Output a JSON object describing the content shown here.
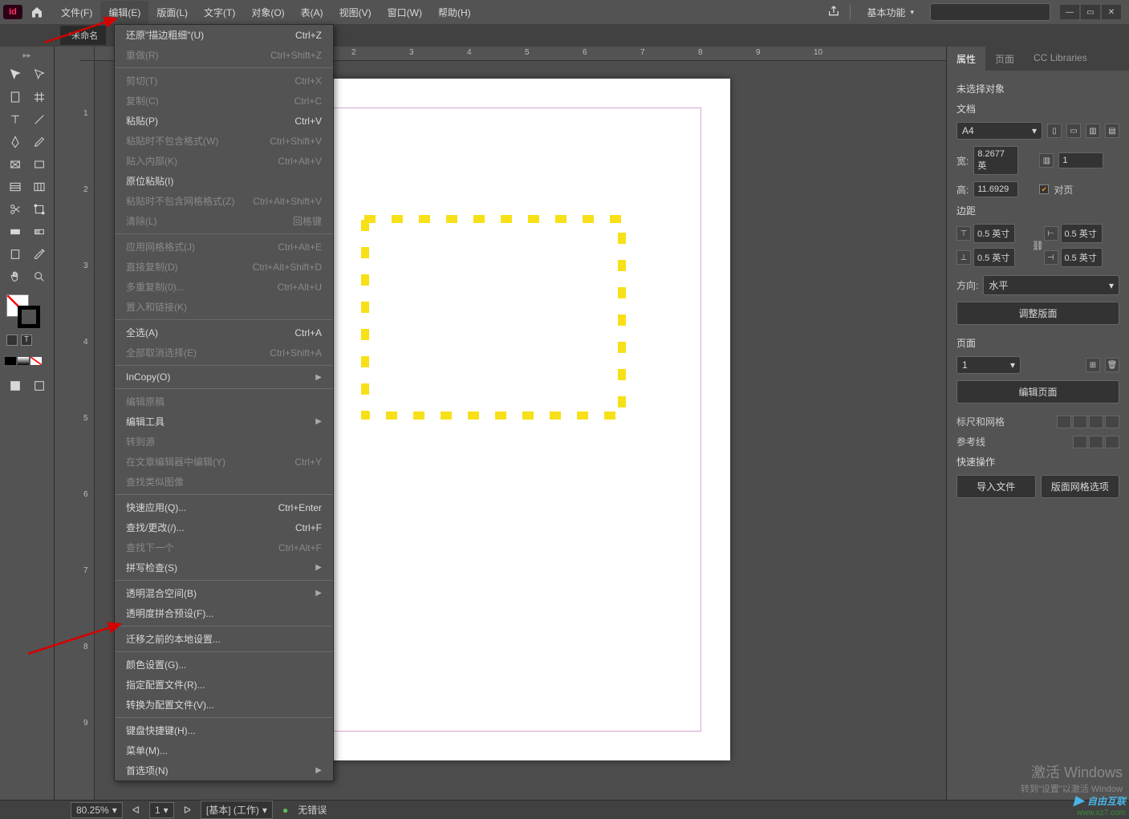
{
  "app": {
    "logo": "Id"
  },
  "menubar": {
    "items": [
      "文件(F)",
      "编辑(E)",
      "版面(L)",
      "文字(T)",
      "对象(O)",
      "表(A)",
      "视图(V)",
      "窗口(W)",
      "帮助(H)"
    ],
    "active_index": 1
  },
  "workspace": {
    "label": "基本功能"
  },
  "doc_tab": {
    "title": "*未命名"
  },
  "dropdown": {
    "groups": [
      [
        {
          "label": "还原\"描边粗细\"(U)",
          "sc": "Ctrl+Z",
          "d": false
        },
        {
          "label": "重做(R)",
          "sc": "Ctrl+Shift+Z",
          "d": true
        }
      ],
      [
        {
          "label": "剪切(T)",
          "sc": "Ctrl+X",
          "d": true
        },
        {
          "label": "复制(C)",
          "sc": "Ctrl+C",
          "d": true
        },
        {
          "label": "粘贴(P)",
          "sc": "Ctrl+V",
          "d": false
        },
        {
          "label": "粘贴时不包含格式(W)",
          "sc": "Ctrl+Shift+V",
          "d": true
        },
        {
          "label": "贴入内部(K)",
          "sc": "Ctrl+Alt+V",
          "d": true
        },
        {
          "label": "原位粘贴(I)",
          "sc": "",
          "d": false
        },
        {
          "label": "粘贴时不包含网格格式(Z)",
          "sc": "Ctrl+Alt+Shift+V",
          "d": true
        },
        {
          "label": "清除(L)",
          "sc": "回格键",
          "d": true
        }
      ],
      [
        {
          "label": "应用网格格式(J)",
          "sc": "Ctrl+Alt+E",
          "d": true
        },
        {
          "label": "直接复制(D)",
          "sc": "Ctrl+Alt+Shift+D",
          "d": true
        },
        {
          "label": "多重复制(0)...",
          "sc": "Ctrl+Alt+U",
          "d": true
        },
        {
          "label": "置入和链接(K)",
          "sc": "",
          "d": true
        }
      ],
      [
        {
          "label": "全选(A)",
          "sc": "Ctrl+A",
          "d": false
        },
        {
          "label": "全部取消选择(E)",
          "sc": "Ctrl+Shift+A",
          "d": true
        }
      ],
      [
        {
          "label": "InCopy(O)",
          "sc": "",
          "d": false,
          "sub": true
        }
      ],
      [
        {
          "label": "编辑原稿",
          "sc": "",
          "d": true
        },
        {
          "label": "编辑工具",
          "sc": "",
          "d": false,
          "sub": true
        },
        {
          "label": "转到源",
          "sc": "",
          "d": true
        },
        {
          "label": "在文章编辑器中编辑(Y)",
          "sc": "Ctrl+Y",
          "d": true
        },
        {
          "label": "查找类似图像",
          "sc": "",
          "d": true
        }
      ],
      [
        {
          "label": "快速应用(Q)...",
          "sc": "Ctrl+Enter",
          "d": false
        },
        {
          "label": "查找/更改(/)...",
          "sc": "Ctrl+F",
          "d": false
        },
        {
          "label": "查找下一个",
          "sc": "Ctrl+Alt+F",
          "d": true
        },
        {
          "label": "拼写检查(S)",
          "sc": "",
          "d": false,
          "sub": true
        }
      ],
      [
        {
          "label": "透明混合空间(B)",
          "sc": "",
          "d": false,
          "sub": true
        },
        {
          "label": "透明度拼合预设(F)...",
          "sc": "",
          "d": false
        }
      ],
      [
        {
          "label": "迁移之前的本地设置...",
          "sc": "",
          "d": false
        }
      ],
      [
        {
          "label": "颜色设置(G)...",
          "sc": "",
          "d": false
        },
        {
          "label": "指定配置文件(R)...",
          "sc": "",
          "d": false
        },
        {
          "label": "转换为配置文件(V)...",
          "sc": "",
          "d": false
        }
      ],
      [
        {
          "label": "键盘快捷键(H)...",
          "sc": "",
          "d": false
        },
        {
          "label": "菜单(M)...",
          "sc": "",
          "d": false
        },
        {
          "label": "首选项(N)",
          "sc": "",
          "d": false,
          "sub": true
        }
      ]
    ]
  },
  "ruler_h": [
    "2",
    "3",
    "4",
    "5",
    "6",
    "7",
    "8",
    "9",
    "10"
  ],
  "ruler_v": [
    "1",
    "2",
    "3",
    "4",
    "5",
    "6",
    "7",
    "8",
    "9"
  ],
  "panel": {
    "tabs": [
      "属性",
      "页面",
      "CC Libraries"
    ],
    "no_selection": "未选择对象",
    "doc_label": "文档",
    "preset": "A4",
    "width_label": "宽:",
    "width": "8.2677 英",
    "height_label": "高:",
    "height": "11.6929",
    "cols": "1",
    "facing_label": "对页",
    "margin_label": "边距",
    "m_top": "0.5 英寸",
    "m_bottom": "0.5 英寸",
    "m_left": "0.5 英寸",
    "m_right": "0.5 英寸",
    "orient_label": "方向:",
    "orient_val": "水平",
    "adjust_btn": "调整版面",
    "pages_label": "页面",
    "page_val": "1",
    "edit_pages_btn": "编辑页面",
    "ruler_grid_label": "标尺和网格",
    "guides_label": "参考线",
    "quick_label": "快速操作",
    "import_btn": "导入文件",
    "grid_opt_btn": "版面网格选项"
  },
  "status": {
    "zoom": "80.25%",
    "page": "1",
    "layer_info": "[基本] (工作)",
    "errors": "无错误"
  },
  "watermark": {
    "l1": "激活 Windows",
    "l2": "转到\"设置\"以激活 Window"
  },
  "brand": {
    "text": "自由互联",
    "url": "www.xz7.com"
  }
}
